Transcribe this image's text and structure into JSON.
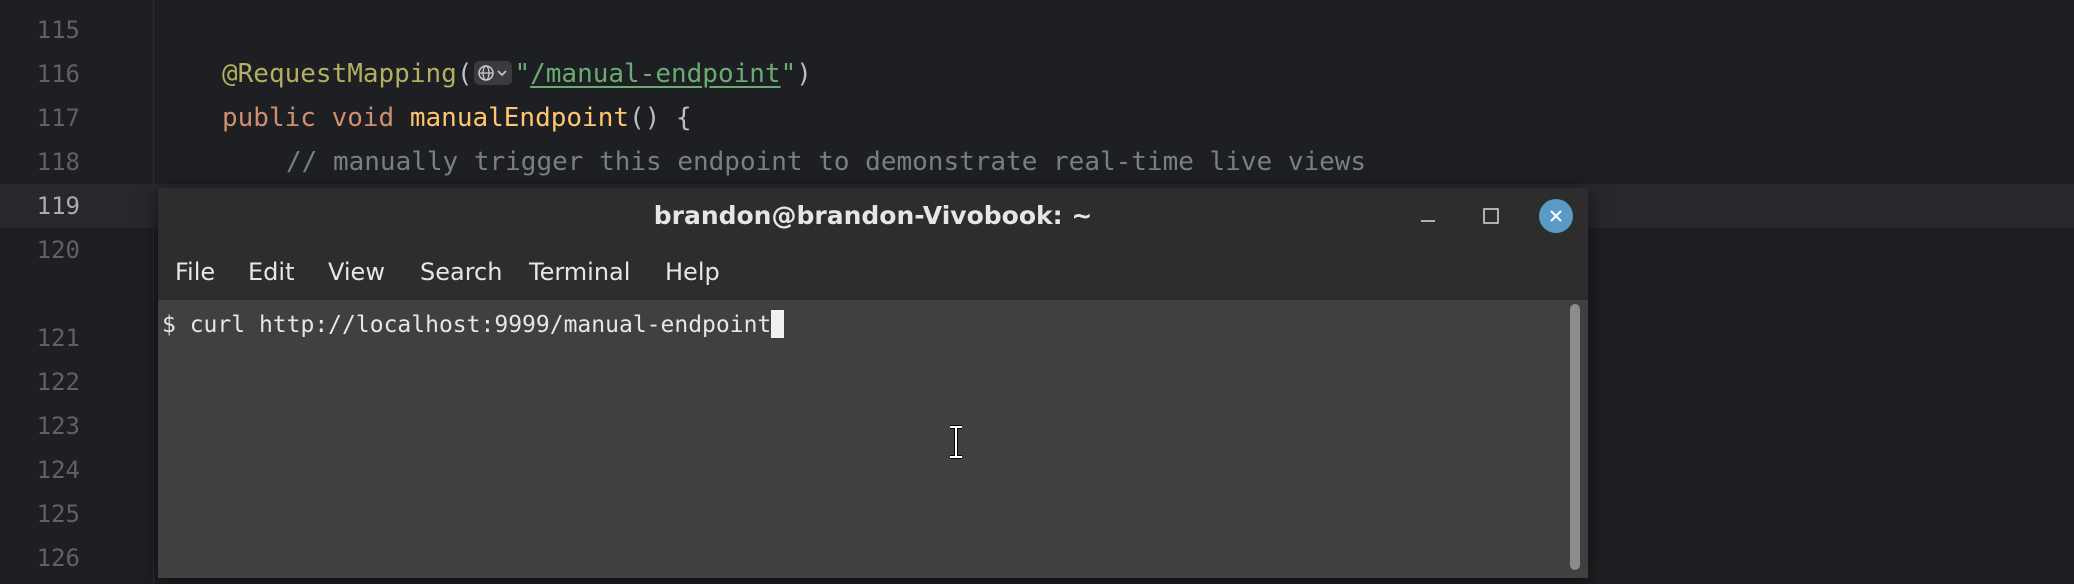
{
  "editor": {
    "lines": [
      {
        "num": "115"
      },
      {
        "num": "116",
        "tokens": {
          "annotation": "@RequestMapping",
          "open_paren": "(",
          "open_quote": "\"",
          "path": "/manual-endpoint",
          "close_quote": "\"",
          "close_paren": ")"
        }
      },
      {
        "num": "117",
        "tokens": {
          "kw_public": "public",
          "kw_void": "void",
          "method": "manualEndpoint",
          "rest": "() {"
        }
      },
      {
        "num": "118",
        "tokens": {
          "comment": "// manually trigger this endpoint to demonstrate real-time live views"
        }
      },
      {
        "num": "119"
      },
      {
        "num": "120"
      },
      {
        "num": "121"
      },
      {
        "num": "122"
      },
      {
        "num": "123"
      },
      {
        "num": "124"
      },
      {
        "num": "125"
      },
      {
        "num": "126"
      }
    ],
    "icons": {
      "url_badge": "globe-icon",
      "badge_chevron": "chevron-down-icon"
    }
  },
  "terminal": {
    "title": "brandon@brandon-Vivobook: ~",
    "menu": [
      "File",
      "Edit",
      "View",
      "Search",
      "Terminal",
      "Help"
    ],
    "prompt": "$ ",
    "command": "curl http://localhost:9999/manual-endpoint",
    "colors": {
      "close_button": "#5a9ac4",
      "body_bg": "#404040",
      "titlebar_bg": "#2d2d2d"
    },
    "icons": {
      "minimize": "minimize-icon",
      "maximize": "maximize-icon",
      "close": "close-icon",
      "pointer": "text-cursor-icon"
    }
  }
}
